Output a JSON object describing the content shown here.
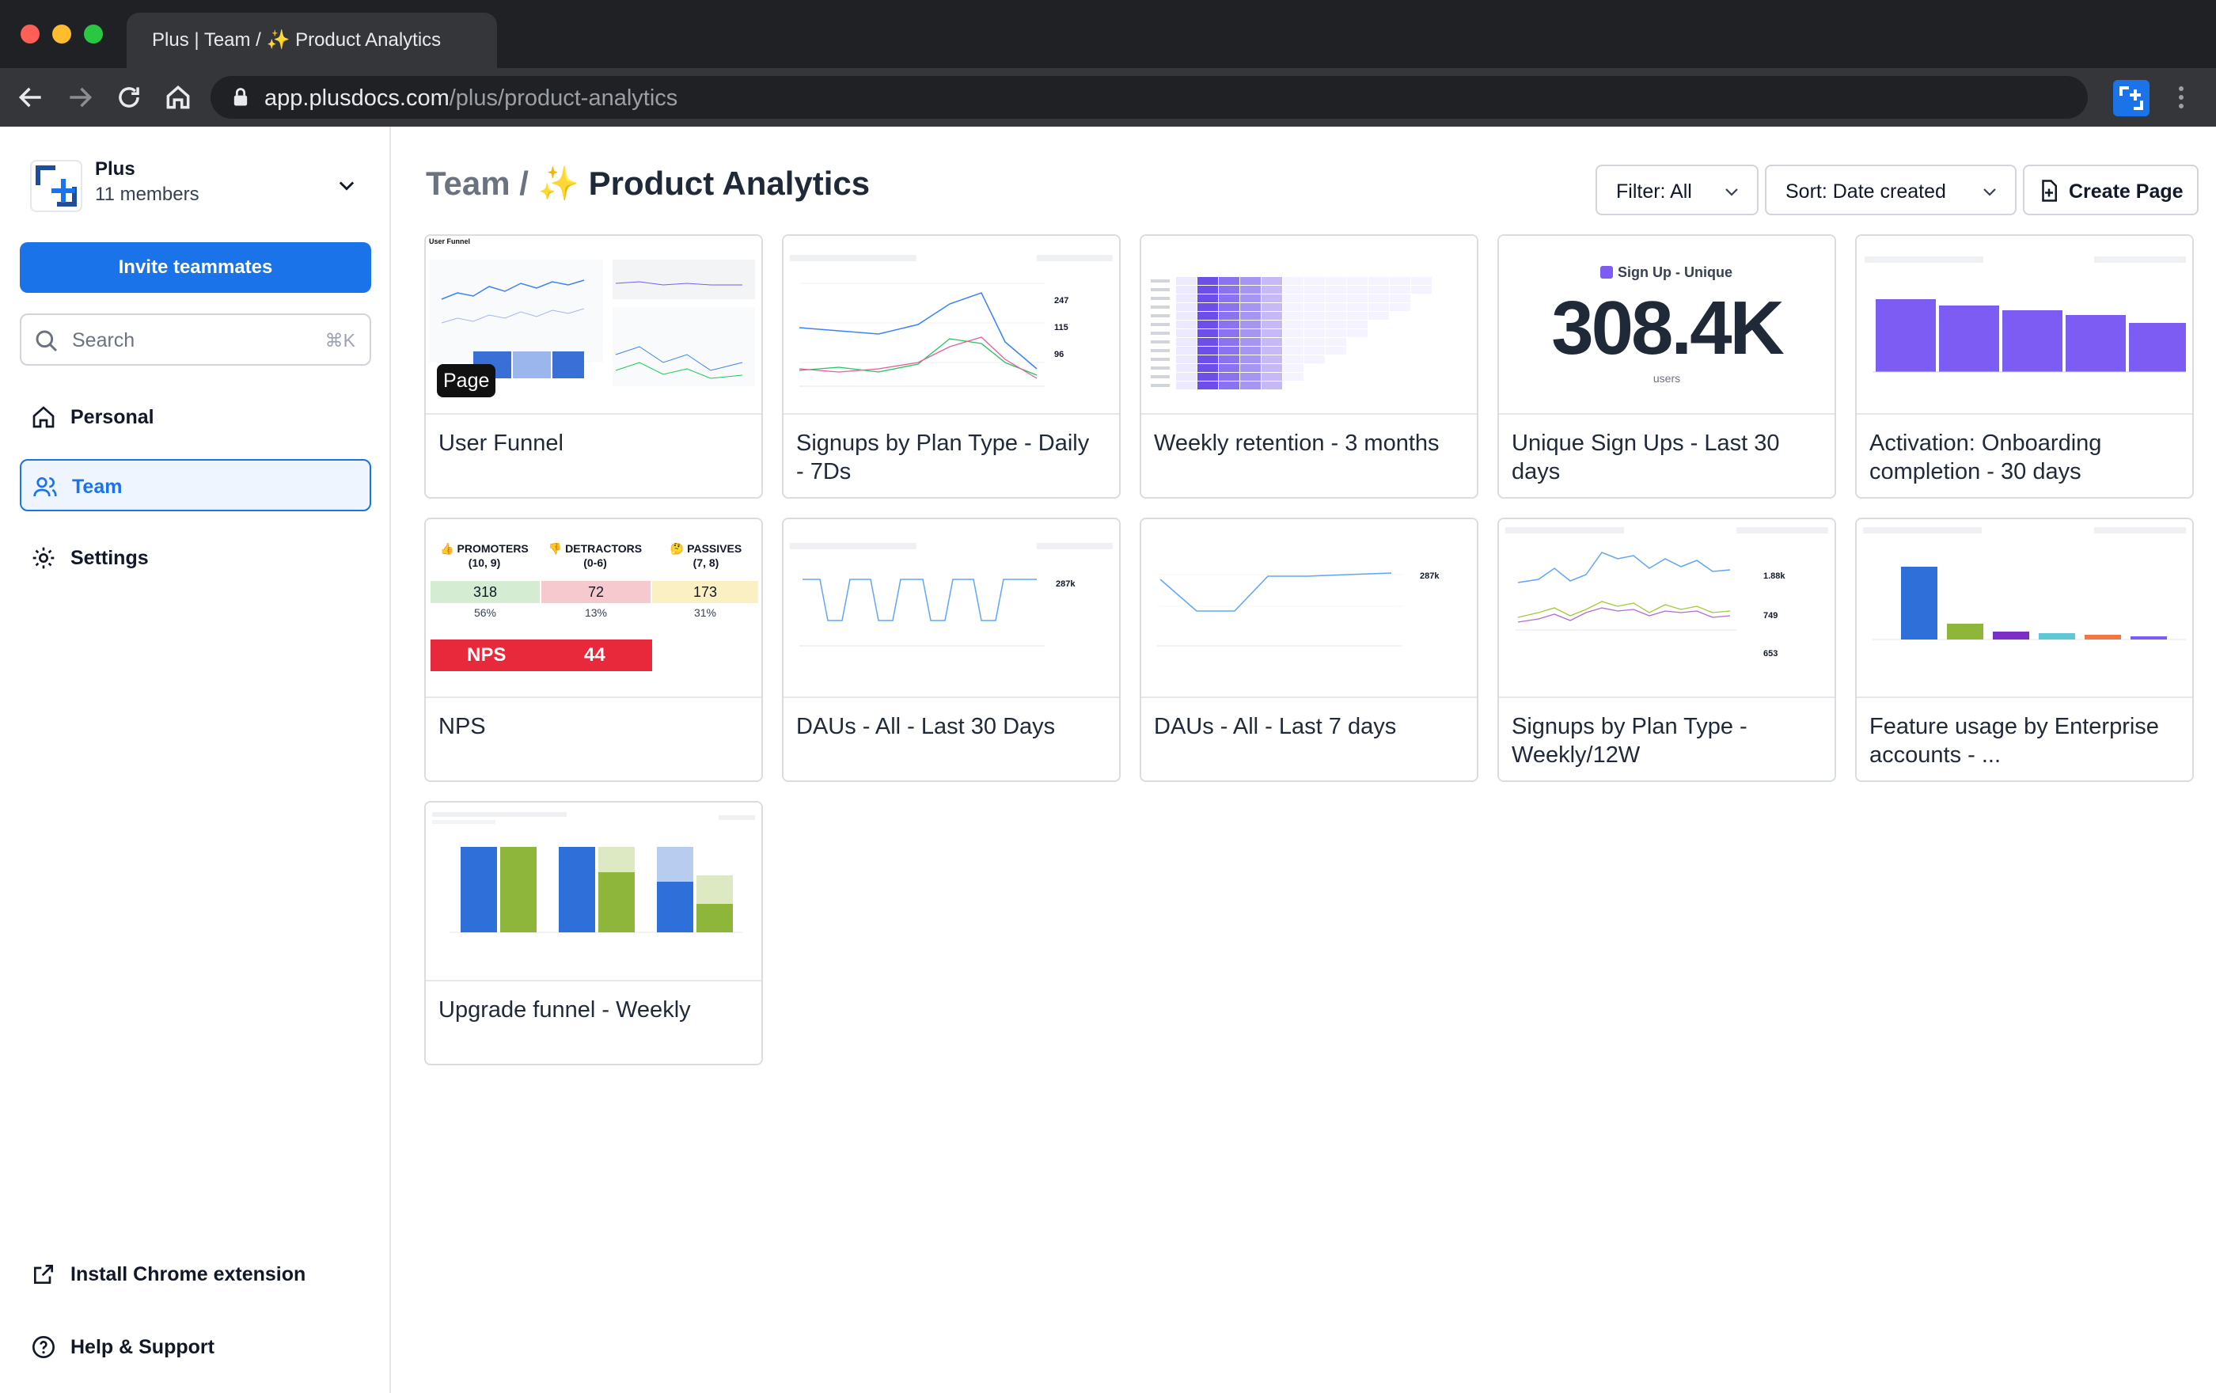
{
  "browser": {
    "tab_title": "Plus | Team / ✨ Product Analytics",
    "url_host": "app.plusdocs.com",
    "url_path": "/plus/product-analytics"
  },
  "sidebar": {
    "workspace_name": "Plus",
    "workspace_members": "11 members",
    "invite_label": "Invite teammates",
    "search_placeholder": "Search",
    "search_shortcut": "⌘K",
    "nav": [
      {
        "label": "Personal",
        "icon": "home-icon"
      },
      {
        "label": "Team",
        "icon": "team-icon",
        "active": true
      },
      {
        "label": "Settings",
        "icon": "gear-icon"
      }
    ],
    "footer": [
      {
        "label": "Install Chrome extension",
        "icon": "external-link-icon"
      },
      {
        "label": "Help & Support",
        "icon": "help-icon"
      }
    ]
  },
  "main": {
    "breadcrumb": "Team",
    "breadcrumb_sep": "/",
    "title": "✨ Product Analytics",
    "filter_label": "Filter: All",
    "sort_label": "Sort: Date created",
    "create_label": "Create Page"
  },
  "cards": [
    {
      "title": "User Funnel",
      "badge": "Page",
      "thumb_caption": "User Funnel"
    },
    {
      "title": "Signups by Plan Type - Daily - 7Ds",
      "thumb_values": [
        "247",
        "115",
        "96"
      ]
    },
    {
      "title": "Weekly retention - 3 months"
    },
    {
      "title": "Unique Sign Ups - Last 30 days",
      "thumb_metric_label": "Sign Up - Unique",
      "thumb_metric": "308.4K",
      "thumb_unit": "users"
    },
    {
      "title": "Activation: Onboarding completion - 30 days"
    },
    {
      "title": "NPS",
      "nps": {
        "promoters": {
          "label": "👍 PROMOTERS",
          "range": "(10, 9)",
          "count": "318",
          "pct": "56%"
        },
        "detractors": {
          "label": "👎 DETRACTORS",
          "range": "(0-6)",
          "count": "72",
          "pct": "13%"
        },
        "passives": {
          "label": "🤔 PASSIVES",
          "range": "(7, 8)",
          "count": "173",
          "pct": "31%"
        },
        "score_label": "NPS",
        "score": "44"
      }
    },
    {
      "title": "DAUs - All - Last 30 Days",
      "thumb_value": "287k"
    },
    {
      "title": "DAUs - All - Last 7 days",
      "thumb_value": "287k"
    },
    {
      "title": "Signups by Plan Type - Weekly/12W",
      "thumb_values": [
        "1.88k",
        "749",
        "653"
      ]
    },
    {
      "title": "Feature usage by Enterprise accounts - ..."
    },
    {
      "title": "Upgrade funnel - Weekly"
    }
  ],
  "colors": {
    "accent": "#1a73e8",
    "purple": "#7c5cf2",
    "nps_red": "#e8293b"
  }
}
